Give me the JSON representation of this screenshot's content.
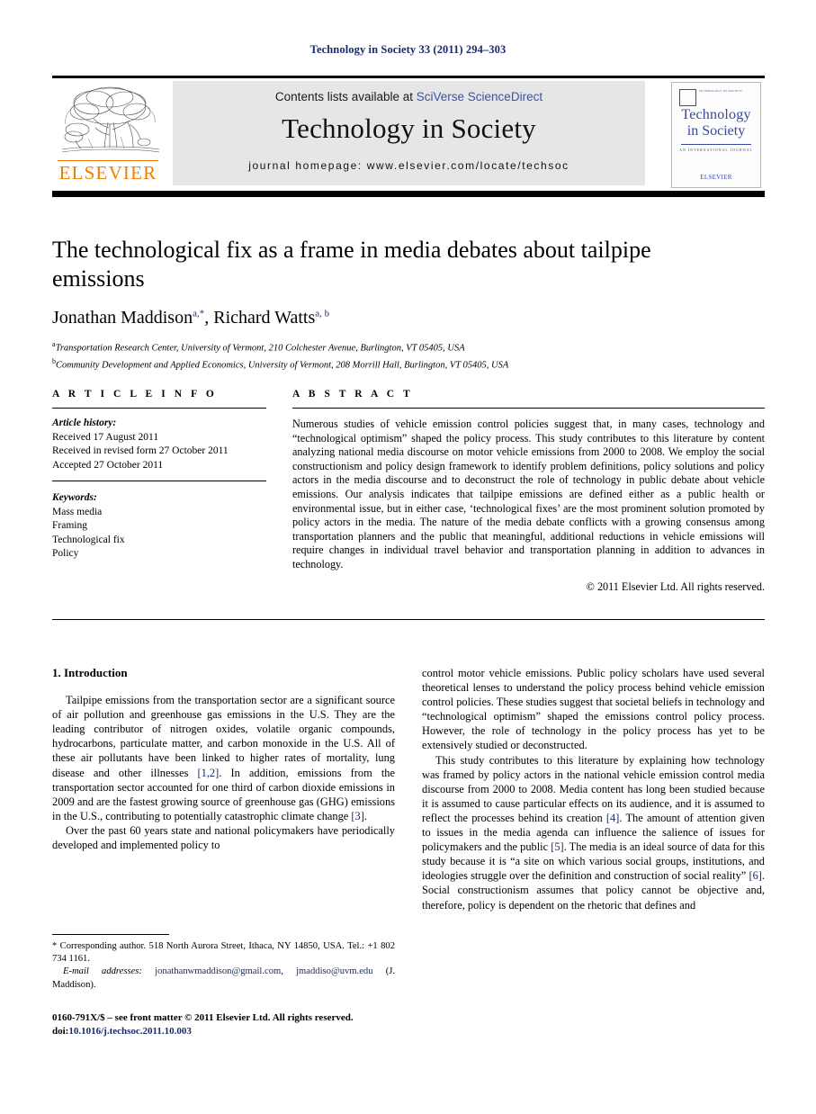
{
  "running_head": "Technology in Society 33 (2011) 294–303",
  "masthead": {
    "contents_prefix": "Contents lists available at ",
    "sciencedirect_link": "SciVerse ScienceDirect",
    "journal_name": "Technology in Society",
    "homepage": "journal homepage: www.elsevier.com/locate/techsoc",
    "publisher_wordmark": "ELSEVIER",
    "link_color": "#3a53a4",
    "publisher_color": "#f07d00",
    "panel_color": "#e6e6e6"
  },
  "cover": {
    "top_text": "TECHNOLOGY IN SOCIETY",
    "title_line1": "Technology",
    "title_line2": "in Society",
    "subtitle": "AN INTERNATIONAL JOURNAL",
    "publisher": "ELSEVIER",
    "accent_color": "#39499a"
  },
  "article": {
    "title": "The technological fix as a frame in media debates about tailpipe emissions",
    "authors": [
      {
        "name": "Jonathan Maddison",
        "marks": "a,*"
      },
      {
        "name": "Richard Watts",
        "marks": "a, b"
      }
    ],
    "affiliation_a_mark": "a",
    "affiliation_a": "Transportation Research Center, University of Vermont, 210 Colchester Avenue, Burlington, VT 05405, USA",
    "affiliation_b_mark": "b",
    "affiliation_b": "Community Development and Applied Economics, University of Vermont, 208 Morrill Hall, Burlington, VT 05405, USA"
  },
  "article_info": {
    "heading": "A R T I C L E  I N F O",
    "history_label": "Article history:",
    "history": [
      "Received 17 August 2011",
      "Received in revised form 27 October 2011",
      "Accepted 27 October 2011"
    ],
    "keywords_label": "Keywords:",
    "keywords": [
      "Mass media",
      "Framing",
      "Technological fix",
      "Policy"
    ]
  },
  "abstract": {
    "heading": "A B S T R A C T",
    "text": "Numerous studies of vehicle emission control policies suggest that, in many cases, technology and “technological optimism” shaped the policy process. This study contributes to this literature by content analyzing national media discourse on motor vehicle emissions from 2000 to 2008. We employ the social constructionism and policy design framework to identify problem definitions, policy solutions and policy actors in the media discourse and to deconstruct the role of technology in public debate about vehicle emissions. Our analysis indicates that tailpipe emissions are defined either as a public health or environmental issue, but in either case, ‘technological fixes’ are the most prominent solution promoted by policy actors in the media. The nature of the media debate conflicts with a growing consensus among transportation planners and the public that meaningful, additional reductions in vehicle emissions will require changes in individual travel behavior and transportation planning in addition to advances in technology.",
    "copyright": "© 2011 Elsevier Ltd. All rights reserved."
  },
  "body": {
    "section_title": "1. Introduction",
    "left_para_1_a": "Tailpipe emissions from the transportation sector are a significant source of air pollution and greenhouse gas emissions in the U.S. They are the leading contributor of nitrogen oxides, volatile organic compounds, hydrocarbons, particulate matter, and carbon monoxide in the U.S. All of these air pollutants have been linked to higher rates of mortality, lung disease and other illnesses ",
    "left_para_1_ref1": "[1,2]",
    "left_para_1_b": ". In addition, emissions from the transportation sector accounted for one third of carbon dioxide emissions in 2009 and are the fastest growing source of greenhouse gas (GHG) emissions in the U.S., contributing to potentially catastrophic climate change ",
    "left_para_1_ref2": "[3]",
    "left_para_1_c": ".",
    "left_para_2": "Over the past 60 years state and national policymakers have periodically developed and implemented policy to",
    "right_para_1": "control motor vehicle emissions. Public policy scholars have used several theoretical lenses to understand the policy process behind vehicle emission control policies. These studies suggest that societal beliefs in technology and “technological optimism” shaped the emissions control policy process. However, the role of technology in the policy process has yet to be extensively studied or deconstructed.",
    "right_para_2_a": "This study contributes to this literature by explaining how technology was framed by policy actors in the national vehicle emission control media discourse from 2000 to 2008. Media content has long been studied because it is assumed to cause particular effects on its audience, and it is assumed to reflect the processes behind its creation ",
    "right_para_2_ref4": "[4]",
    "right_para_2_b": ". The amount of attention given to issues in the media agenda can influence the salience of issues for policymakers and the public ",
    "right_para_2_ref5": "[5]",
    "right_para_2_c": ". The media is an ideal source of data for this study because it is “a site on which various social groups, institutions, and ideologies struggle over the definition and construction of social reality” ",
    "right_para_2_ref6": "[6]",
    "right_para_2_d": ". Social constructionism assumes that policy cannot be objective and, therefore, policy is dependent on the rhetoric that defines and"
  },
  "footnote": {
    "corresponding": "* Corresponding author. 518 North Aurora Street, Ithaca, NY 14850, USA. Tel.: +1 802 734 1161.",
    "email_label": "E-mail addresses:",
    "email_1": "jonathanwmaddison@gmail.com",
    "email_sep": ", ",
    "email_2": "jmaddiso@uvm.edu",
    "email_suffix": " (J. Maddison)."
  },
  "imprint": {
    "issn_line": "0160-791X/$ – see front matter © 2011 Elsevier Ltd. All rights reserved.",
    "doi_label": "doi:",
    "doi_value": "10.1016/j.techsoc.2011.10.003"
  }
}
